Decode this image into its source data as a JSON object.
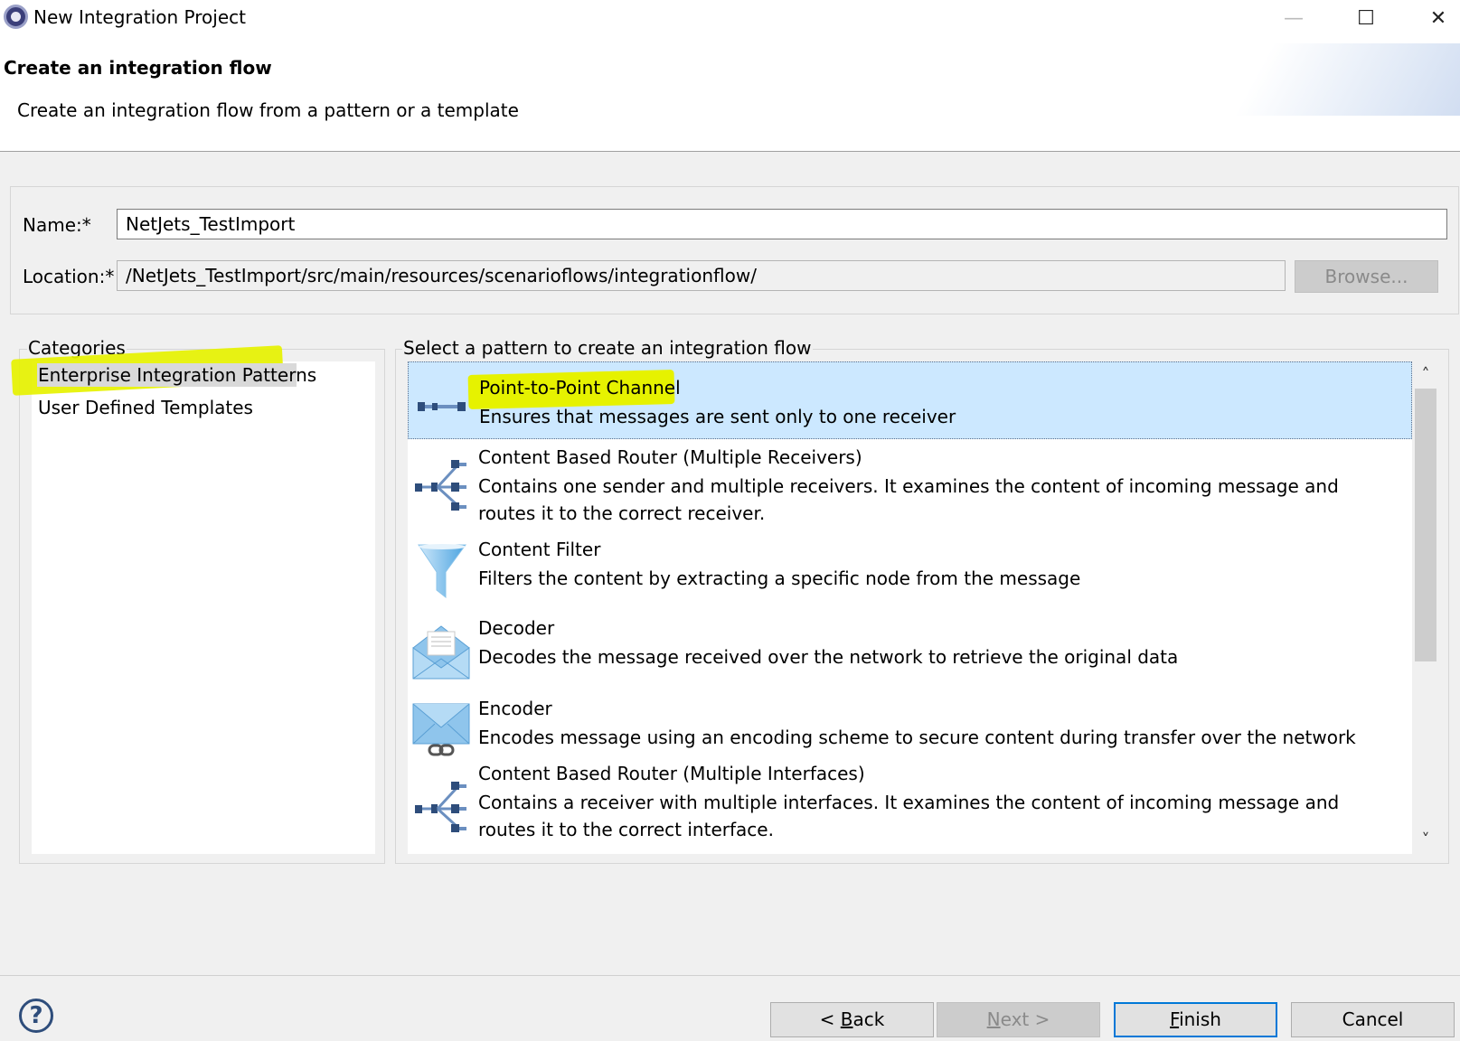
{
  "window": {
    "title": "New Integration Project",
    "minimize_glyph": "—",
    "maximize_glyph": "☐",
    "close_glyph": "✕"
  },
  "header": {
    "title": "Create an integration flow",
    "description": "Create an integration flow from a pattern or a template"
  },
  "form": {
    "name_label": "Name:*",
    "name_value": "NetJets_TestImport",
    "location_label": "Location:*",
    "location_value": "/NetJets_TestImport/src/main/resources/scenarioflows/integrationflow/",
    "browse_label": "Browse..."
  },
  "categories": {
    "label": "Categories",
    "items": [
      {
        "label": "Enterprise Integration Patterns",
        "selected": true
      },
      {
        "label": "User Defined Templates",
        "selected": false
      }
    ]
  },
  "patterns": {
    "label": "Select a pattern to create an integration flow",
    "items": [
      {
        "title": "Point-to-Point Channel",
        "description": "Ensures that messages are sent only to one receiver",
        "icon": "point-to-point-icon",
        "selected": true
      },
      {
        "title": "Content Based Router (Multiple Receivers)",
        "description_lines": [
          "Contains one sender and multiple receivers. It examines the content of incoming message and",
          "routes it to the correct receiver."
        ],
        "icon": "router-icon"
      },
      {
        "title": "Content Filter",
        "description": "Filters the content by extracting a specific node from the message",
        "icon": "funnel-icon"
      },
      {
        "title": "Decoder",
        "description": "Decodes the message received over the network to retrieve the original data",
        "icon": "open-envelope-icon"
      },
      {
        "title": "Encoder",
        "description": "Encodes message using an encoding scheme to secure content during transfer over the network",
        "icon": "envelope-chain-icon"
      },
      {
        "title": "Content Based Router (Multiple Interfaces)",
        "description_lines": [
          "Contains a receiver with multiple interfaces. It examines the content of incoming message and",
          "routes it to the correct interface."
        ],
        "icon": "router-icon"
      }
    ]
  },
  "scroll": {
    "up_glyph": "˄",
    "down_glyph": "˅"
  },
  "footer": {
    "help_glyph": "?",
    "back_prefix": "< ",
    "back_mnemonic": "B",
    "back_rest": "ack",
    "next_mnemonic": "N",
    "next_rest": "ext >",
    "finish_mnemonic": "F",
    "finish_rest": "inish",
    "cancel_label": "Cancel"
  },
  "colors": {
    "selection": "#cce8ff",
    "highlighter": "#e6f200",
    "icon_blue": "#2e4d7b",
    "default_button_border": "#0078d7"
  }
}
